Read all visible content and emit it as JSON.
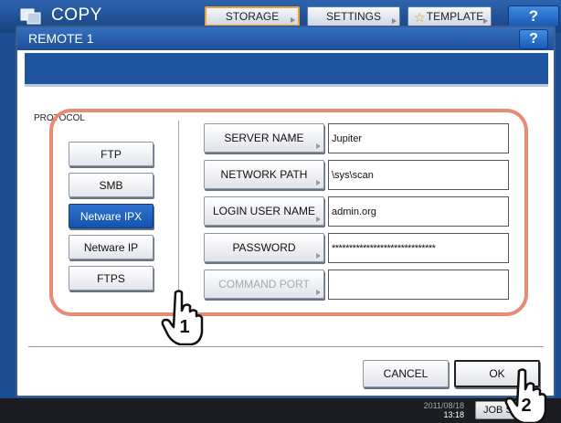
{
  "app": {
    "title": "COPY"
  },
  "toolbar": {
    "storage_label": "STORAGE",
    "settings_label": "SETTINGS",
    "template_label": "TEMPLATE",
    "help_label": "?"
  },
  "status_bar": {
    "clock_line1": "2011/08/18",
    "clock_line2": "13:18",
    "job_status_label": "JOB ST"
  },
  "dialog": {
    "title": "REMOTE 1",
    "help_label": "?",
    "protocol_label": "PROTOCOL",
    "protocols": [
      {
        "label": "FTP",
        "selected": false
      },
      {
        "label": "SMB",
        "selected": false
      },
      {
        "label": "Netware IPX",
        "selected": true
      },
      {
        "label": "Netware IP",
        "selected": false
      },
      {
        "label": "FTPS",
        "selected": false
      }
    ],
    "fields": [
      {
        "label": "SERVER NAME",
        "value": "Jupiter",
        "enabled": true
      },
      {
        "label": "NETWORK PATH",
        "value": "\\sys\\scan",
        "enabled": true
      },
      {
        "label": "LOGIN USER NAME",
        "value": "admin.org",
        "enabled": true
      },
      {
        "label": "PASSWORD",
        "value": "******************************",
        "enabled": true
      },
      {
        "label": "COMMAND PORT",
        "value": "",
        "enabled": false
      }
    ],
    "cancel_label": "CANCEL",
    "ok_label": "OK"
  },
  "callouts": {
    "step1": "1",
    "step2": "2"
  },
  "colors": {
    "header_blue": "#1d4e98",
    "selected_blue": "#1554ad",
    "highlight_salmon": "#e88b74",
    "storage_accent": "#e8a33a"
  },
  "icons": [
    "copy-app-icon",
    "star-icon",
    "help-icon",
    "pointing-hand-icon"
  ]
}
